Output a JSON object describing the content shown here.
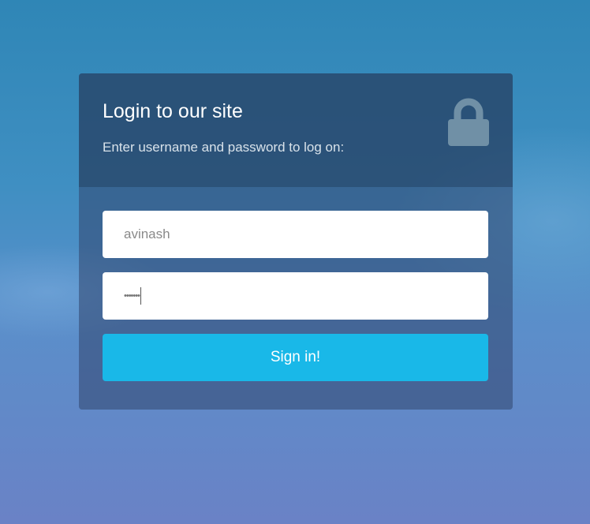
{
  "form": {
    "title": "Login to our site",
    "subtitle": "Enter username and password to log on:",
    "lock_icon": "lock-icon",
    "username_value": "avinash",
    "password_value": "•••••••",
    "submit_label": "Sign in!",
    "accent_color": "#19b8e8"
  }
}
